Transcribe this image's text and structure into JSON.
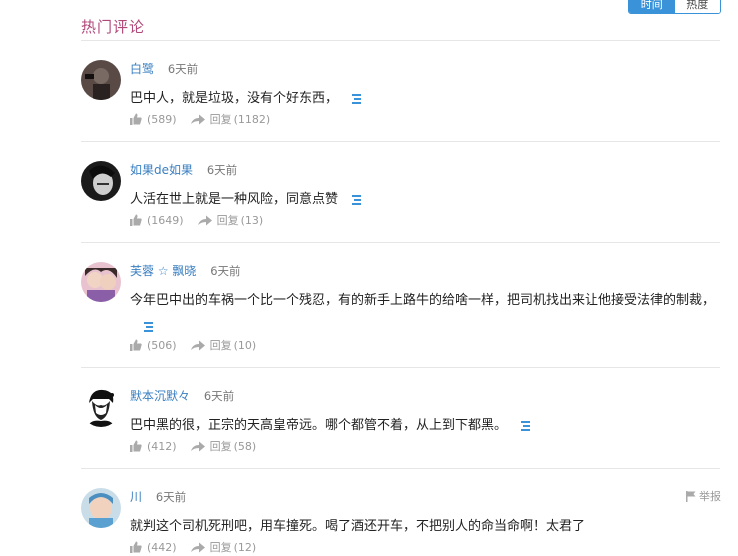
{
  "header": {
    "title": "热门评论"
  },
  "sort_tabs": [
    {
      "label": "时间",
      "active": true
    },
    {
      "label": "热度",
      "active": false
    }
  ],
  "colors": {
    "accent": "#3a92d8",
    "title": "#b1487a",
    "username": "#3a7fc1"
  },
  "comments": [
    {
      "username": "白鹭",
      "time": "6天前",
      "text": "巴中人，就是垃圾，没有个好东西，",
      "likes": "(589)",
      "reply_label": "回复",
      "reply_count": "(1182)"
    },
    {
      "username": "如果de如果",
      "time": "6天前",
      "text": "人活在世上就是一种风险，同意点赞",
      "likes": "(1649)",
      "reply_label": "回复",
      "reply_count": "(13)"
    },
    {
      "username": "芙蓉 ☆ 飘晓",
      "time": "6天前",
      "text": "今年巴中出的车祸一个比一个残忍，有的新手上路牛的给啥一样，把司机找出来让他接受法律的制裁，",
      "likes": "(506)",
      "reply_label": "回复",
      "reply_count": "(10)"
    },
    {
      "username": "默本沉默々",
      "time": "6天前",
      "text": "巴中黑的很，正宗的天高皇帝远。哪个都管不着，从上到下都黑。",
      "likes": "(412)",
      "reply_label": "回复",
      "reply_count": "(58)"
    },
    {
      "username": "川",
      "time": "6天前",
      "text": "就判这个司机死刑吧，用车撞死。喝了酒还开车，不把别人的命当命啊！太君了",
      "likes": "(442)",
      "reply_label": "回复",
      "reply_count": "(12)",
      "report_label": "举报"
    }
  ]
}
